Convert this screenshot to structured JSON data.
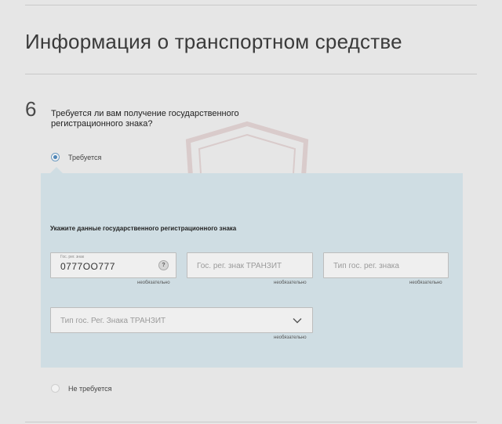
{
  "section": {
    "title": "Информация о транспортном средстве"
  },
  "step": {
    "number": "6",
    "question": "Требуется ли вам получение государственного регистрационного знака?"
  },
  "options": {
    "required_label": "Требуется",
    "not_required_label": "Не требуется",
    "selected": "required"
  },
  "plate_panel": {
    "title": "Укажите данные государственного регистрационного знака",
    "fields": {
      "plate_number": {
        "label": "Гос. рег. знак",
        "value": "0777ОО777",
        "help": "?",
        "note": "необязательно"
      },
      "transit_plate": {
        "placeholder": "Гос. рег. знак ТРАНЗИТ",
        "note": "необязательно"
      },
      "plate_type": {
        "placeholder": "Тип гос. рег. знака",
        "note": "необязательно"
      },
      "transit_plate_type": {
        "placeholder": "Тип гос. Рег. Знака ТРАНЗИТ",
        "note": "необязательно"
      }
    }
  },
  "icons": {
    "watermark": "shield-car-icon",
    "select_arrow": "chevron-down-icon"
  },
  "colors": {
    "background": "#e6e6e6",
    "panel": "#cfdde3",
    "radio_accent": "#4f86b8"
  }
}
